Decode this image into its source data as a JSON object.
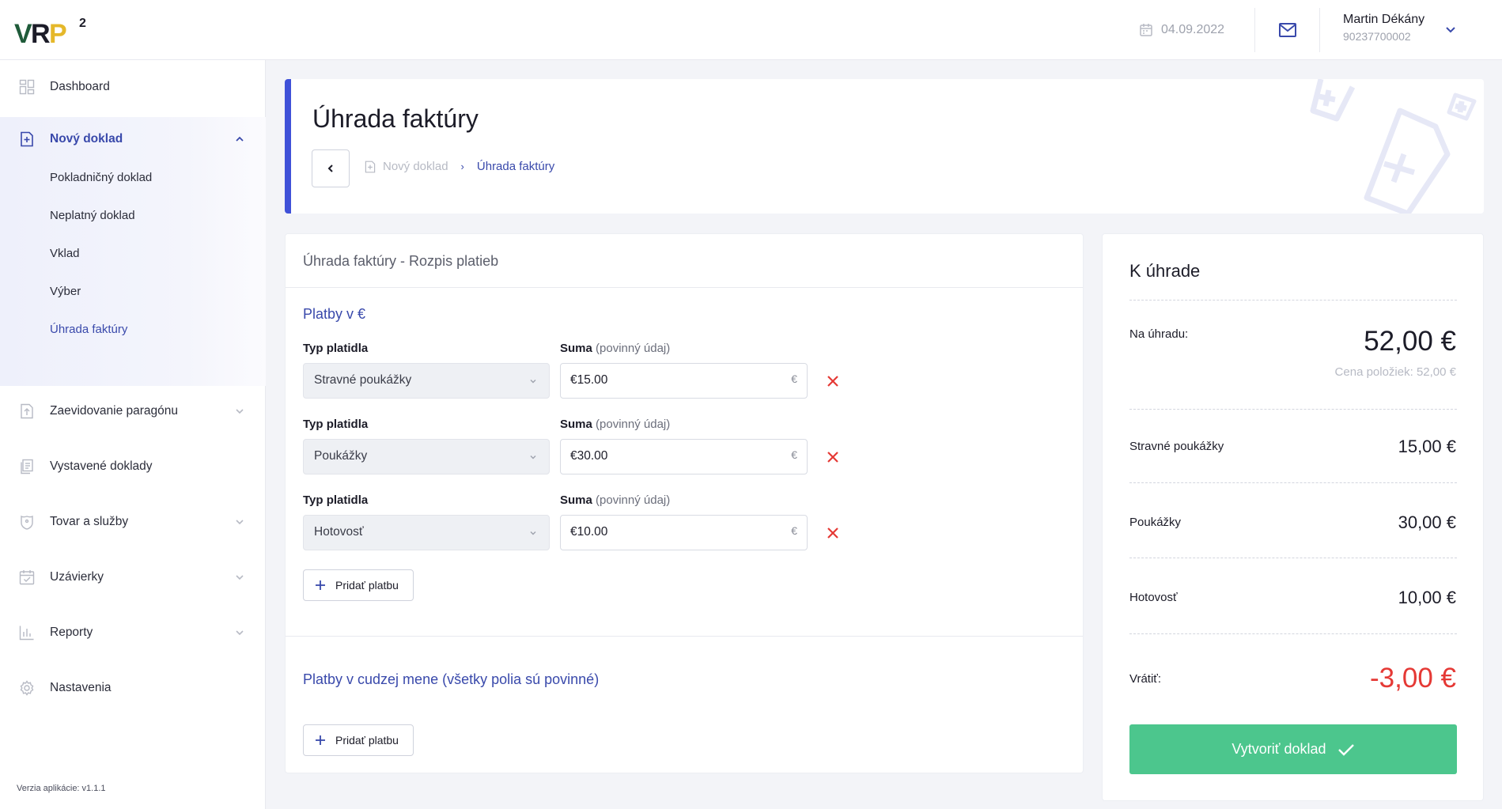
{
  "header": {
    "logo_text": "VRP",
    "logo_sup": "2",
    "date": "04.09.2022",
    "user_name": "Martin Dékány",
    "user_id": "90237700002"
  },
  "sidebar": {
    "items": [
      {
        "label": "Dashboard",
        "icon": "dashboard-icon"
      },
      {
        "label": "Nový doklad",
        "icon": "new-document-icon"
      },
      {
        "label": "Zaevidovanie paragónu",
        "icon": "upload-document-icon"
      },
      {
        "label": "Vystavené doklady",
        "icon": "documents-icon"
      },
      {
        "label": "Tovar a služby",
        "icon": "tag-icon"
      },
      {
        "label": "Uzávierky",
        "icon": "calendar-check-icon"
      },
      {
        "label": "Reporty",
        "icon": "chart-icon"
      },
      {
        "label": "Nastavenia",
        "icon": "gear-icon"
      }
    ],
    "sub_items": [
      {
        "label": "Pokladničný doklad"
      },
      {
        "label": "Neplatný doklad"
      },
      {
        "label": "Vklad"
      },
      {
        "label": "Výber"
      },
      {
        "label": "Úhrada faktúry"
      }
    ],
    "version": "Verzia aplikácie: v1.1.1"
  },
  "page": {
    "title": "Úhrada faktúry",
    "breadcrumb": [
      "Nový doklad",
      "Úhrada faktúry"
    ]
  },
  "payments": {
    "card_title": "Úhrada faktúry - Rozpis platieb",
    "eur_section_title": "Platby v €",
    "type_label": "Typ platidla",
    "amount_label_bold": "Suma",
    "amount_label_muted": "(povinný údaj)",
    "currency_symbol": "€",
    "rows": [
      {
        "type": "Stravné poukážky",
        "amount": "€15.00"
      },
      {
        "type": "Poukážky",
        "amount": "€30.00"
      },
      {
        "type": "Hotovosť",
        "amount": "€10.00"
      }
    ],
    "add_label": "Pridať platbu",
    "foreign_section_title": "Platby v cudzej mene (všetky polia sú povinné)"
  },
  "summary": {
    "title": "K úhrade",
    "due_label": "Na úhradu:",
    "due_value": "52,00 €",
    "items_price": "Cena položiek: 52,00 €",
    "lines": [
      {
        "label": "Stravné poukážky",
        "value": "15,00 €"
      },
      {
        "label": "Poukážky",
        "value": "30,00 €"
      },
      {
        "label": "Hotovosť",
        "value": "10,00 €"
      }
    ],
    "return_label": "Vrátiť:",
    "return_value": "-3,00 €",
    "create_label": "Vytvoriť doklad",
    "colors": {
      "accent": "#3f51d8",
      "success": "#4cc68d",
      "danger": "#e53935"
    }
  }
}
